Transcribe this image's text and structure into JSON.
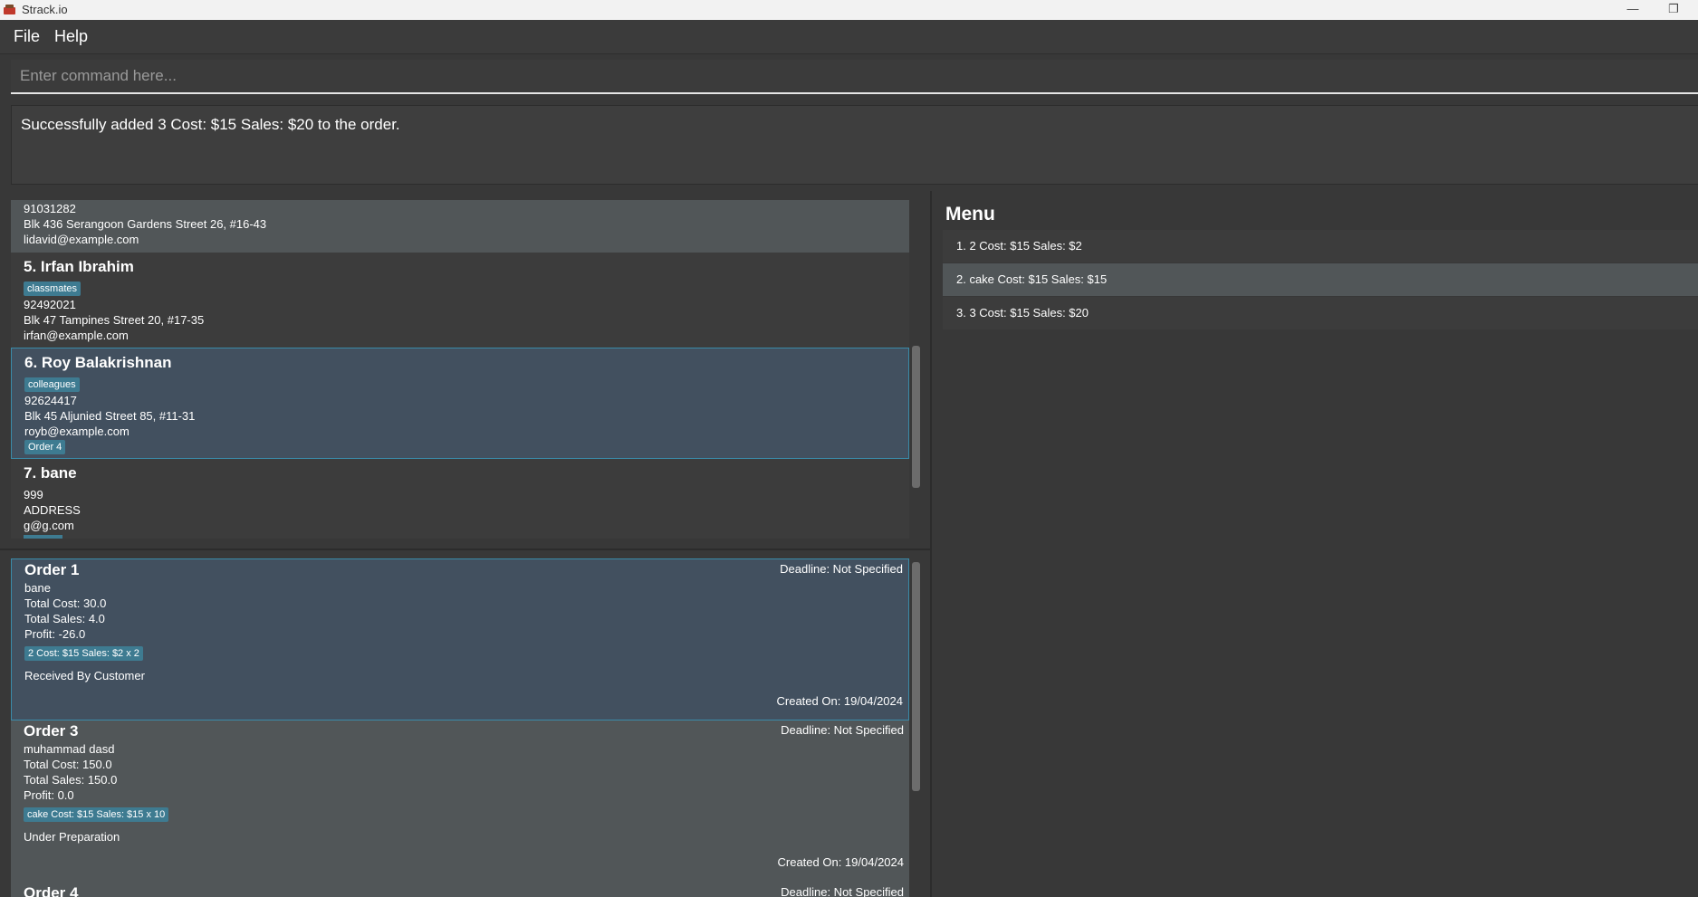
{
  "window": {
    "title": "Strack.io",
    "minimize": "—",
    "restore": "❐"
  },
  "menubar": {
    "file": "File",
    "help": "Help"
  },
  "command": {
    "placeholder": "Enter command here..."
  },
  "result": {
    "message": "Successfully added 3 Cost: $15 Sales: $20 to the order."
  },
  "persons": [
    {
      "phone": "91031282",
      "address": "Blk 436 Serangoon Gardens Street 26, #16-43",
      "email": "lidavid@example.com"
    },
    {
      "title": "5.  Irfan Ibrahim",
      "tag": "classmates",
      "phone": "92492021",
      "address": "Blk 47 Tampines Street 20, #17-35",
      "email": "irfan@example.com"
    },
    {
      "title": "6.  Roy Balakrishnan",
      "tag": "colleagues",
      "phone": "92624417",
      "address": "Blk 45 Aljunied Street 85, #11-31",
      "email": "royb@example.com",
      "order_tag": "Order 4"
    },
    {
      "title": "7.  bane",
      "phone": "999",
      "address": "ADDRESS",
      "email": "g@g.com"
    }
  ],
  "orders": [
    {
      "title": "Order 1",
      "deadline": "Deadline: Not Specified",
      "customer": "bane",
      "total_cost": "Total Cost: 30.0",
      "total_sales": "Total Sales: 4.0",
      "profit": "Profit: -26.0",
      "item": "2 Cost: $15 Sales: $2 x 2",
      "status": "Received By Customer",
      "created": "Created On: 19/04/2024"
    },
    {
      "title": "Order 3",
      "deadline": "Deadline: Not Specified",
      "customer": "muhammad dasd",
      "total_cost": "Total Cost: 150.0",
      "total_sales": "Total Sales: 150.0",
      "profit": "Profit: 0.0",
      "item": "cake Cost: $15 Sales: $15 x 10",
      "status": "Under Preparation",
      "created": "Created On: 19/04/2024"
    },
    {
      "title": "Order 4",
      "deadline": "Deadline: Not Specified"
    }
  ],
  "menu": {
    "title": "Menu",
    "items": [
      "1. 2  Cost: $15  Sales: $2",
      "2. cake  Cost: $15  Sales: $15",
      "3. 3  Cost: $15  Sales: $20"
    ]
  },
  "colors": {
    "accent": "#3e7b91",
    "selected_bg": "#42505f",
    "selected_border": "#3a8ba9"
  }
}
